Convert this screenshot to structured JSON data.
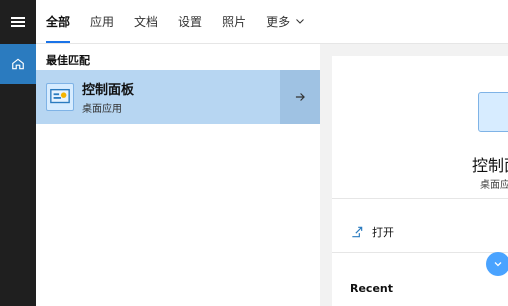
{
  "tabs": [
    {
      "label": "全部",
      "active": true
    },
    {
      "label": "应用",
      "active": false
    },
    {
      "label": "文档",
      "active": false
    },
    {
      "label": "设置",
      "active": false
    },
    {
      "label": "照片",
      "active": false
    },
    {
      "label": "更多",
      "active": false
    }
  ],
  "results": {
    "section_title": "最佳匹配",
    "best_match": {
      "title": "控制面板",
      "subtitle": "桌面应用",
      "icon": "control-panel-icon"
    }
  },
  "preview": {
    "title": "控制面",
    "subtitle": "桌面应",
    "open_label": "打开",
    "recent_label": "Recent"
  },
  "colors": {
    "accent": "#1a73e8",
    "selected_bg": "#b7d6f2",
    "arrow_bg": "#9fc2e3",
    "rail_bg": "#1f1f1f",
    "home_bg": "#2b7bbf"
  }
}
